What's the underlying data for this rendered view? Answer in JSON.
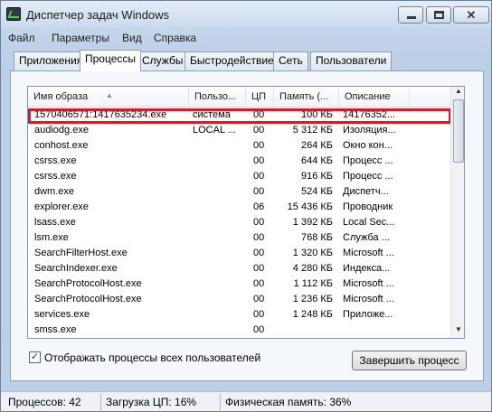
{
  "window": {
    "title": "Диспетчер задач Windows",
    "icon": "task-manager-icon"
  },
  "menu": [
    "Файл",
    "Параметры",
    "Вид",
    "Справка"
  ],
  "tabs": [
    {
      "label": "Приложения",
      "active": false
    },
    {
      "label": "Процессы",
      "active": true
    },
    {
      "label": "Службы",
      "active": false
    },
    {
      "label": "Быстродействие",
      "active": false
    },
    {
      "label": "Сеть",
      "active": false
    },
    {
      "label": "Пользователи",
      "active": false
    }
  ],
  "table": {
    "columns": [
      "Имя образа",
      "Пользо...",
      "ЦП",
      "Память (...",
      "Описание"
    ],
    "sort_column": "Имя образа",
    "rows": [
      {
        "name": "1570406571:1417635234.exe",
        "user": "система",
        "cpu": "00",
        "mem": "100 КБ",
        "desc": "14176352...",
        "highlighted": true
      },
      {
        "name": "audiodg.exe",
        "user": "LOCAL ...",
        "cpu": "00",
        "mem": "5 312 КБ",
        "desc": "Изоляция..."
      },
      {
        "name": "conhost.exe",
        "user": "",
        "cpu": "00",
        "mem": "264 КБ",
        "desc": "Окно кон..."
      },
      {
        "name": "csrss.exe",
        "user": "",
        "cpu": "00",
        "mem": "644 КБ",
        "desc": "Процесс ..."
      },
      {
        "name": "csrss.exe",
        "user": "",
        "cpu": "00",
        "mem": "916 КБ",
        "desc": "Процесс ..."
      },
      {
        "name": "dwm.exe",
        "user": "",
        "cpu": "00",
        "mem": "524 КБ",
        "desc": "Диспетч..."
      },
      {
        "name": "explorer.exe",
        "user": "",
        "cpu": "06",
        "mem": "15 436 КБ",
        "desc": "Проводник"
      },
      {
        "name": "lsass.exe",
        "user": "",
        "cpu": "00",
        "mem": "1 392 КБ",
        "desc": "Local Sec..."
      },
      {
        "name": "lsm.exe",
        "user": "",
        "cpu": "00",
        "mem": "768 КБ",
        "desc": "Служба ..."
      },
      {
        "name": "SearchFilterHost.exe",
        "user": "",
        "cpu": "00",
        "mem": "1 320 КБ",
        "desc": "Microsoft ..."
      },
      {
        "name": "SearchIndexer.exe",
        "user": "",
        "cpu": "00",
        "mem": "4 280 КБ",
        "desc": "Индекса..."
      },
      {
        "name": "SearchProtocolHost.exe",
        "user": "",
        "cpu": "00",
        "mem": "1 112 КБ",
        "desc": "Microsoft ..."
      },
      {
        "name": "SearchProtocolHost.exe",
        "user": "",
        "cpu": "00",
        "mem": "1 236 КБ",
        "desc": "Microsoft ..."
      },
      {
        "name": "services.exe",
        "user": "",
        "cpu": "00",
        "mem": "1 248 КБ",
        "desc": "Приложе..."
      },
      {
        "name": "smss.exe",
        "user": "",
        "cpu": "00",
        "mem": "",
        "desc": ""
      }
    ]
  },
  "show_all_users": {
    "label": "Отображать процессы всех пользователей",
    "checked": true,
    "check_glyph": "✓"
  },
  "end_process_label": "Завершить процесс",
  "status": {
    "processes": "Процессов: 42",
    "cpu": "Загрузка ЦП: 16%",
    "memory": "Физическая память: 36%"
  },
  "colors": {
    "highlight": "#d11d2a",
    "window_bg": "#c6d6ea"
  }
}
